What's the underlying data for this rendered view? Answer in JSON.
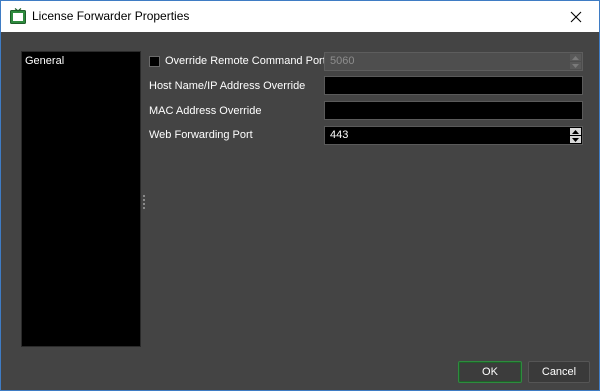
{
  "window": {
    "title": "License Forwarder Properties",
    "accent_color": "#2e8b3e",
    "icon": "tv-icon",
    "close_icon": "close-icon"
  },
  "sidebar": {
    "items": [
      {
        "label": "General",
        "selected": true
      }
    ]
  },
  "form": {
    "override_remote_command_port": {
      "label": "Override Remote Command Port",
      "checked": false,
      "value": "5060",
      "enabled": false
    },
    "host_name_override": {
      "label": "Host Name/IP Address Override",
      "value": ""
    },
    "mac_address_override": {
      "label": "MAC Address Override",
      "value": ""
    },
    "web_forwarding_port": {
      "label": "Web Forwarding Port",
      "value": "443"
    }
  },
  "buttons": {
    "ok_label": "OK",
    "cancel_label": "Cancel"
  }
}
